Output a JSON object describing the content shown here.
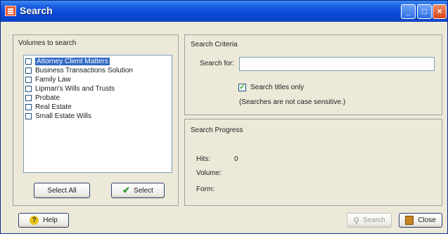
{
  "window": {
    "title": "Search"
  },
  "volumes": {
    "label": "Volumes to search",
    "items": [
      {
        "label": "Attorney Client Matters",
        "checked": false,
        "selected": true
      },
      {
        "label": "Business Transactions Solution",
        "checked": false,
        "selected": false
      },
      {
        "label": "Family Law",
        "checked": false,
        "selected": false
      },
      {
        "label": "Lipman's Wills and Trusts",
        "checked": false,
        "selected": false
      },
      {
        "label": "Probate",
        "checked": false,
        "selected": false
      },
      {
        "label": "Real Estate",
        "checked": false,
        "selected": false
      },
      {
        "label": "Small Estate Wills",
        "checked": false,
        "selected": false
      }
    ],
    "select_all_label": "Select All",
    "select_label": "Select"
  },
  "criteria": {
    "label": "Search Criteria",
    "search_for_label": "Search for:",
    "search_value": "",
    "titles_only_label": "Search titles only",
    "titles_only_checked": true,
    "case_note": "(Searches are not case sensitive.)"
  },
  "progress": {
    "label": "Search Progress",
    "hits_label": "Hits:",
    "hits_value": "0",
    "volume_label": "Volume:",
    "form_label": "Form:"
  },
  "footer": {
    "help_label": "Help",
    "search_label": "Search",
    "close_label": "Close"
  },
  "colors": {
    "titlebar": "#0a48d6",
    "selection": "#316ac5",
    "dialog_bg": "#ece9d8"
  },
  "icons": [
    "app-icon",
    "minimize-icon",
    "maximize-icon",
    "close-icon",
    "help-icon",
    "checkmark-icon",
    "search-icon",
    "close-door-icon"
  ]
}
